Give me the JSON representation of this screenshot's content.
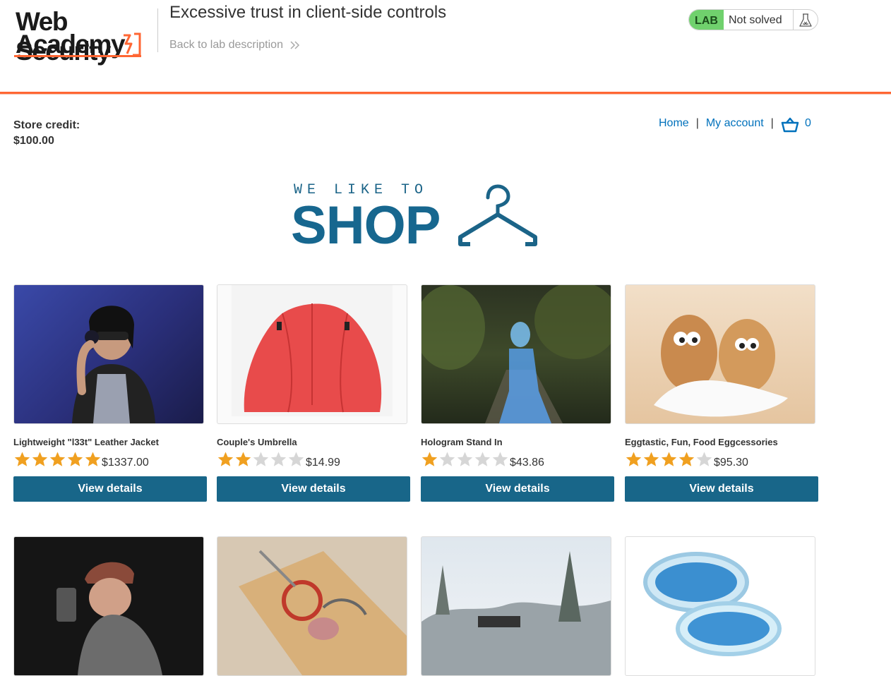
{
  "header": {
    "logo": {
      "line1": "Web Security",
      "line2": "Academy"
    },
    "lab_title": "Excessive trust in client-side controls",
    "back_link": "Back to lab description",
    "lab_badge": {
      "tag": "LAB",
      "status": "Not solved"
    }
  },
  "store": {
    "credit_label": "Store credit:",
    "credit_value": "$100.00"
  },
  "nav": {
    "home": "Home",
    "separator": "|",
    "my_account": "My account",
    "cart_count": "0"
  },
  "banner": {
    "line1": "WE LIKE TO",
    "line2": "SHOP"
  },
  "colors": {
    "accent": "#ff6633",
    "button": "#186689",
    "link": "#0071bc",
    "lab_green": "#70d16d",
    "star": "#f0a020"
  },
  "products": [
    {
      "name": "Lightweight \"l33t\" Leather Jacket",
      "rating": 5,
      "price": "$1337.00",
      "button": "View details"
    },
    {
      "name": "Couple's Umbrella",
      "rating": 2,
      "price": "$14.99",
      "button": "View details"
    },
    {
      "name": "Hologram Stand In",
      "rating": 1,
      "price": "$43.86",
      "button": "View details"
    },
    {
      "name": "Eggtastic, Fun, Food Eggcessories",
      "rating": 4,
      "price": "$95.30",
      "button": "View details"
    }
  ]
}
